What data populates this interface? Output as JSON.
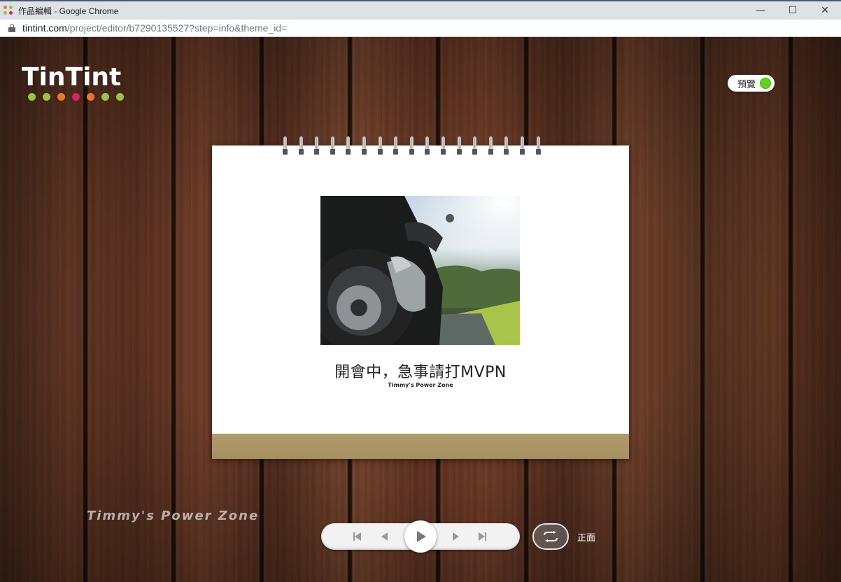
{
  "window": {
    "title": "作品編輯 - Google Chrome",
    "controls": [
      "minimize-icon",
      "maximize-icon",
      "close-icon"
    ]
  },
  "address": {
    "host": "tintint.com",
    "path": "/project/editor/b7290135527?step=info&theme_id="
  },
  "logo": {
    "text": "TinTint",
    "dot_colors": [
      "#9bc53d",
      "#9bc53d",
      "#e8792b",
      "#d3265a",
      "#e8792b",
      "#9bc53d",
      "#9bc53d"
    ]
  },
  "preview": {
    "label": "預覽",
    "enabled": true,
    "accent": "#5ed21f"
  },
  "calendar": {
    "title": "開會中，急事請打MVPN",
    "subtitle": "Timmy's Power Zone",
    "ring_count": 17
  },
  "watermark": "Timmy's Power Zone",
  "player": {
    "buttons": [
      "first-page-icon",
      "prev-page-icon",
      "play-icon",
      "next-page-icon",
      "last-page-icon"
    ]
  },
  "flip": {
    "icon": "flip-icon",
    "label": "正面"
  }
}
